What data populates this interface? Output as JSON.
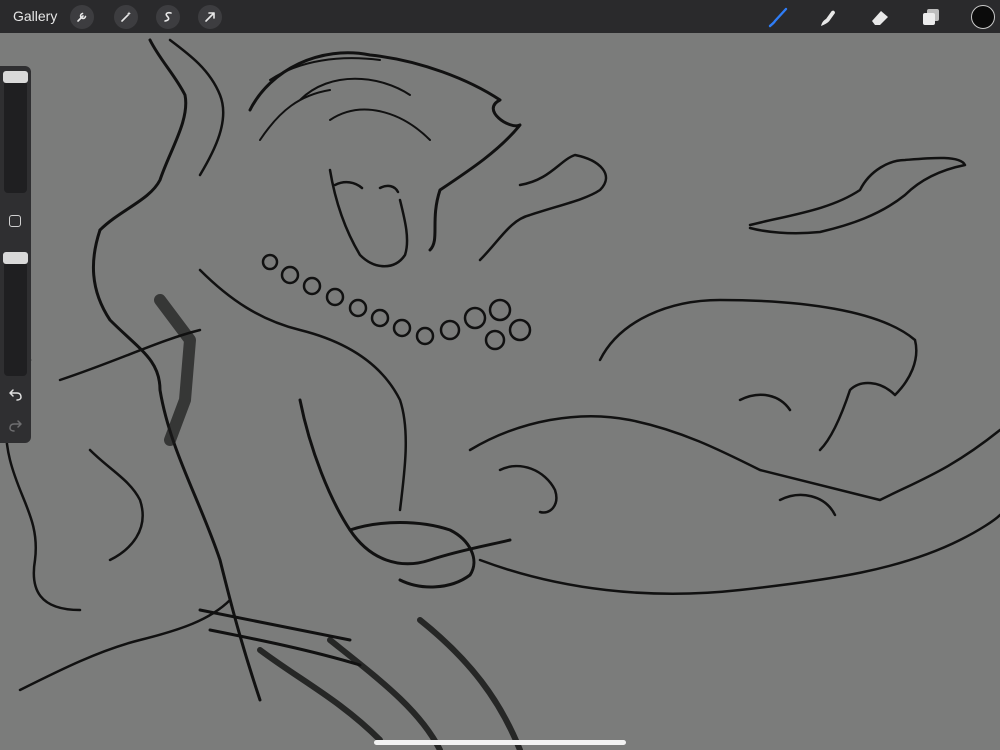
{
  "topbar": {
    "gallery_label": "Gallery",
    "left_tools": [
      {
        "name": "wrench-icon"
      },
      {
        "name": "magic-wand-icon"
      },
      {
        "name": "selection-icon"
      },
      {
        "name": "transform-arrow-icon"
      }
    ],
    "right_tools": [
      {
        "name": "brush-icon",
        "active": true
      },
      {
        "name": "smudge-icon"
      },
      {
        "name": "eraser-icon"
      },
      {
        "name": "layers-icon"
      }
    ],
    "current_color": "#0b0b0b",
    "accent_color": "#2f7df6"
  },
  "sidebar": {
    "tools": [
      "brush-size-slider",
      "modify-button",
      "opacity-slider",
      "undo-icon",
      "redo-icon"
    ]
  },
  "canvas": {
    "background": "#7b7c7b",
    "content": "sketch"
  }
}
